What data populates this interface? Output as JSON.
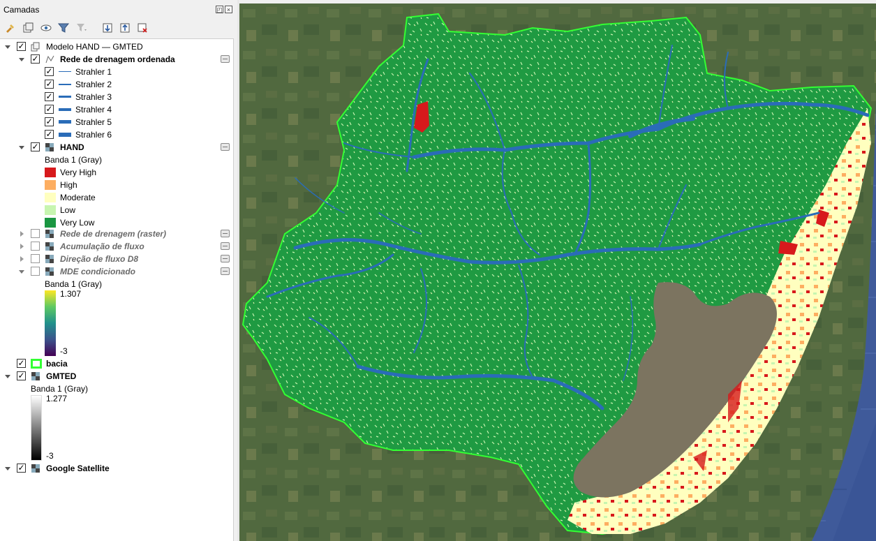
{
  "panel": {
    "title": "Camadas",
    "float_glyph": "◰",
    "close_glyph": "×",
    "toolbar": [
      {
        "name": "style-manager-icon"
      },
      {
        "name": "add-group-icon"
      },
      {
        "name": "visibility-eye-icon"
      },
      {
        "name": "filter-icon"
      },
      {
        "name": "filter-expression-icon"
      },
      {
        "name": "expand-all-icon"
      },
      {
        "name": "collapse-all-icon"
      },
      {
        "name": "remove-layer-icon"
      }
    ]
  },
  "tree": {
    "group": {
      "label": "Modelo HAND — GMTED",
      "checked": true
    },
    "drainage": {
      "label": "Rede de drenagem ordenada",
      "checked": true,
      "classes": [
        {
          "label": "Strahler 1",
          "checked": true,
          "width": 1
        },
        {
          "label": "Strahler 2",
          "checked": true,
          "width": 2
        },
        {
          "label": "Strahler 3",
          "checked": true,
          "width": 3
        },
        {
          "label": "Strahler 4",
          "checked": true,
          "width": 4
        },
        {
          "label": "Strahler 5",
          "checked": true,
          "width": 5
        },
        {
          "label": "Strahler 6",
          "checked": true,
          "width": 6
        }
      ]
    },
    "hand": {
      "label": "HAND",
      "checked": true,
      "band": "Banda 1 (Gray)",
      "classes": [
        {
          "label": "Very High",
          "color": "#d7191c"
        },
        {
          "label": "High",
          "color": "#fdae61"
        },
        {
          "label": "Moderate",
          "color": "#ffffbf"
        },
        {
          "label": "Low",
          "color": "#c7f5b0"
        },
        {
          "label": "Very Low",
          "color": "#1a9641"
        }
      ]
    },
    "hidden_layers": [
      {
        "label": "Rede de drenagem (raster)",
        "checked": false
      },
      {
        "label": "Acumulação de fluxo",
        "checked": false
      },
      {
        "label": "Direção de fluxo D8",
        "checked": false
      }
    ],
    "mde": {
      "label": "MDE condicionado",
      "checked": false,
      "band": "Banda 1 (Gray)",
      "max": "1.307",
      "min": "-3"
    },
    "bacia": {
      "label": "bacia",
      "checked": true,
      "color": "#33ff33"
    },
    "gmted": {
      "label": "GMTED",
      "checked": true,
      "band": "Banda 1 (Gray)",
      "max": "1.277",
      "min": "-3"
    },
    "satellite": {
      "label": "Google Satellite",
      "checked": true
    }
  },
  "map": {
    "colors": {
      "satellite_land": "#51693f",
      "ocean": "#3f5a9a",
      "lagoon": "#7c7460",
      "very_low": "#1f9a42",
      "low": "#c7f5b0",
      "moderate": "#ffffbf",
      "high": "#fdae61",
      "very_high": "#d7191c",
      "rivers": "#2a6cb8",
      "boundary": "#33ff33"
    }
  }
}
